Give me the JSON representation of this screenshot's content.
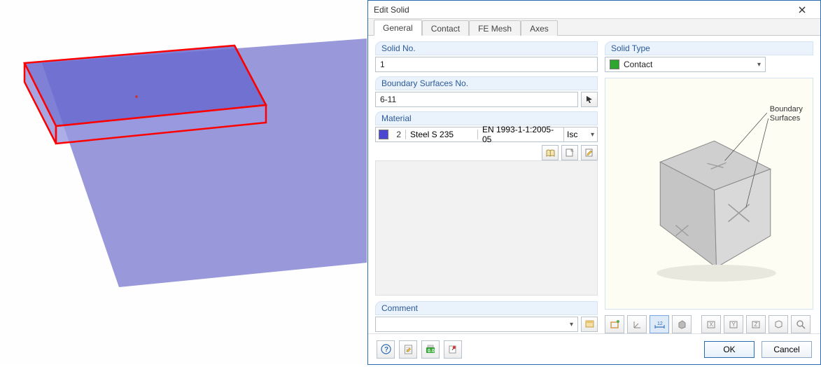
{
  "dialog": {
    "title": "Edit Solid",
    "tabs": [
      "General",
      "Contact",
      "FE Mesh",
      "Axes"
    ],
    "selected_tab": 0,
    "groups": {
      "solid_no": {
        "label": "Solid No.",
        "value": "1"
      },
      "solid_type": {
        "label": "Solid Type",
        "value": "Contact",
        "swatch": "#2fa62f"
      },
      "boundary": {
        "label": "Boundary Surfaces No.",
        "value": "6-11",
        "picker_icon": "arrow-cursor-icon"
      },
      "material": {
        "label": "Material",
        "swatch": "#4b49d1",
        "num": "2",
        "name": "Steel S 235",
        "standard": "EN 1993-1-1:2005-05",
        "model": "Isc",
        "buttons": [
          "library-icon",
          "new-icon",
          "edit-icon"
        ]
      },
      "comment": {
        "label": "Comment",
        "value": "",
        "picker_icon": "comment-list-icon"
      }
    },
    "preview": {
      "annotation": "Boundary\nSurfaces",
      "toolbar_icons": [
        "view-wire-icon",
        "axis-icon",
        "dimension-icon",
        "solid-shade-icon",
        "sectionx-icon",
        "sectiony-icon",
        "sectionz-icon",
        "clip-icon",
        "zoom-icon"
      ],
      "toggled_index": 2
    },
    "footer": {
      "help_icons": [
        "help-icon",
        "notes-icon",
        "calc-icon",
        "pin-icon"
      ],
      "ok": "OK",
      "cancel": "Cancel"
    }
  }
}
